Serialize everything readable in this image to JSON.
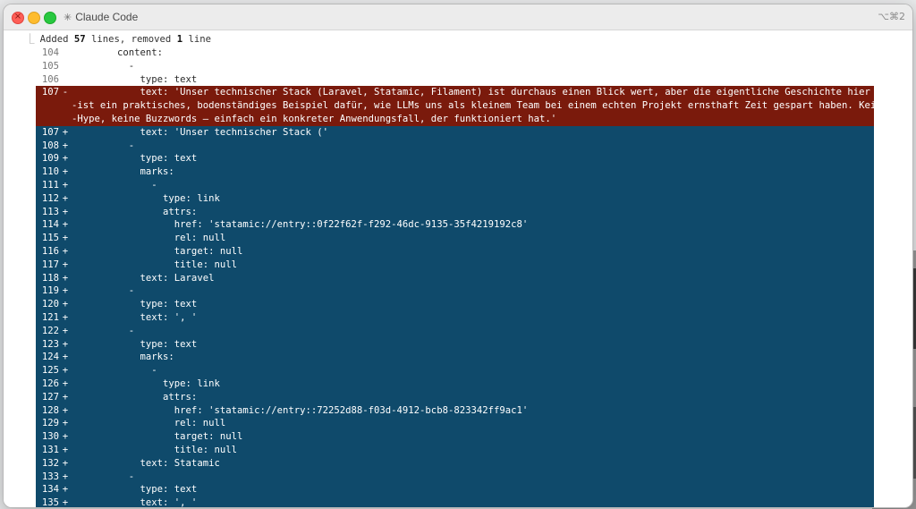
{
  "window": {
    "title": "Claude Code",
    "title_icon": "sparkle-icon",
    "shortcut": "⌥⌘2"
  },
  "diff": {
    "summary_prefix": "Added ",
    "added_count": "57",
    "summary_mid": " lines, removed ",
    "removed_count": "1",
    "summary_suffix": " line",
    "context_lines": [
      {
        "num": "104",
        "sign": "",
        "text": "        content:"
      },
      {
        "num": "105",
        "sign": "",
        "text": "          -"
      },
      {
        "num": "106",
        "sign": "",
        "text": "            type: text"
      }
    ],
    "removed_lines": [
      {
        "num": "107",
        "sign": "-",
        "text": "            text: 'Unser technischer Stack (Laravel, Statamic, Filament) ist durchaus einen Blick wert, aber die eigentliche Geschichte hier"
      },
      {
        "num": "",
        "sign": "",
        "text": "-ist ein praktisches, bodenständiges Beispiel dafür, wie LLMs uns als kleinem Team bei einem echten Projekt ernsthaft Zeit gespart haben. Kein"
      },
      {
        "num": "",
        "sign": "",
        "text": "-Hype, keine Buzzwords – einfach ein konkreter Anwendungsfall, der funktioniert hat.'"
      }
    ],
    "added_lines": [
      {
        "num": "107",
        "sign": "+",
        "text": "            text: 'Unser technischer Stack ('"
      },
      {
        "num": "108",
        "sign": "+",
        "text": "          -"
      },
      {
        "num": "109",
        "sign": "+",
        "text": "            type: text"
      },
      {
        "num": "110",
        "sign": "+",
        "text": "            marks:"
      },
      {
        "num": "111",
        "sign": "+",
        "text": "              -"
      },
      {
        "num": "112",
        "sign": "+",
        "text": "                type: link"
      },
      {
        "num": "113",
        "sign": "+",
        "text": "                attrs:"
      },
      {
        "num": "114",
        "sign": "+",
        "text": "                  href: 'statamic://entry::0f22f62f-f292-46dc-9135-35f4219192c8'"
      },
      {
        "num": "115",
        "sign": "+",
        "text": "                  rel: null"
      },
      {
        "num": "116",
        "sign": "+",
        "text": "                  target: null"
      },
      {
        "num": "117",
        "sign": "+",
        "text": "                  title: null"
      },
      {
        "num": "118",
        "sign": "+",
        "text": "            text: Laravel"
      },
      {
        "num": "119",
        "sign": "+",
        "text": "          -"
      },
      {
        "num": "120",
        "sign": "+",
        "text": "            type: text"
      },
      {
        "num": "121",
        "sign": "+",
        "text": "            text: ', '"
      },
      {
        "num": "122",
        "sign": "+",
        "text": "          -"
      },
      {
        "num": "123",
        "sign": "+",
        "text": "            type: text"
      },
      {
        "num": "124",
        "sign": "+",
        "text": "            marks:"
      },
      {
        "num": "125",
        "sign": "+",
        "text": "              -"
      },
      {
        "num": "126",
        "sign": "+",
        "text": "                type: link"
      },
      {
        "num": "127",
        "sign": "+",
        "text": "                attrs:"
      },
      {
        "num": "128",
        "sign": "+",
        "text": "                  href: 'statamic://entry::72252d88-f03d-4912-bcb8-823342ff9ac1'"
      },
      {
        "num": "129",
        "sign": "+",
        "text": "                  rel: null"
      },
      {
        "num": "130",
        "sign": "+",
        "text": "                  target: null"
      },
      {
        "num": "131",
        "sign": "+",
        "text": "                  title: null"
      },
      {
        "num": "132",
        "sign": "+",
        "text": "            text: Statamic"
      },
      {
        "num": "133",
        "sign": "+",
        "text": "          -"
      },
      {
        "num": "134",
        "sign": "+",
        "text": "            type: text"
      },
      {
        "num": "135",
        "sign": "+",
        "text": "            text: ', '"
      }
    ]
  },
  "colors": {
    "removed_bg": "#7a1a0c",
    "added_bg": "#0f4a6b",
    "close": "#fe5f57",
    "minimize": "#febc2e",
    "maximize": "#28c840"
  }
}
